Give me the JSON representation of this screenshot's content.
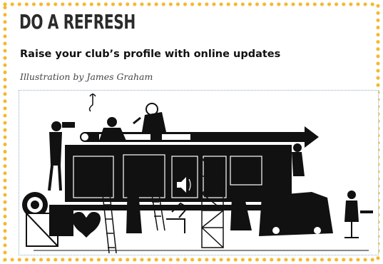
{
  "article": {
    "section_heading": "DO A REFRESH",
    "subheading": "Raise your club’s profile with online updates",
    "credit": "Illustration by James Graham"
  },
  "illustration": {
    "description_icon": "website-construction-illustration"
  },
  "colors": {
    "border_dots": "#f5b82e",
    "ink": "#111111",
    "background": "#ffffff",
    "frame": "#8fb0bd"
  }
}
